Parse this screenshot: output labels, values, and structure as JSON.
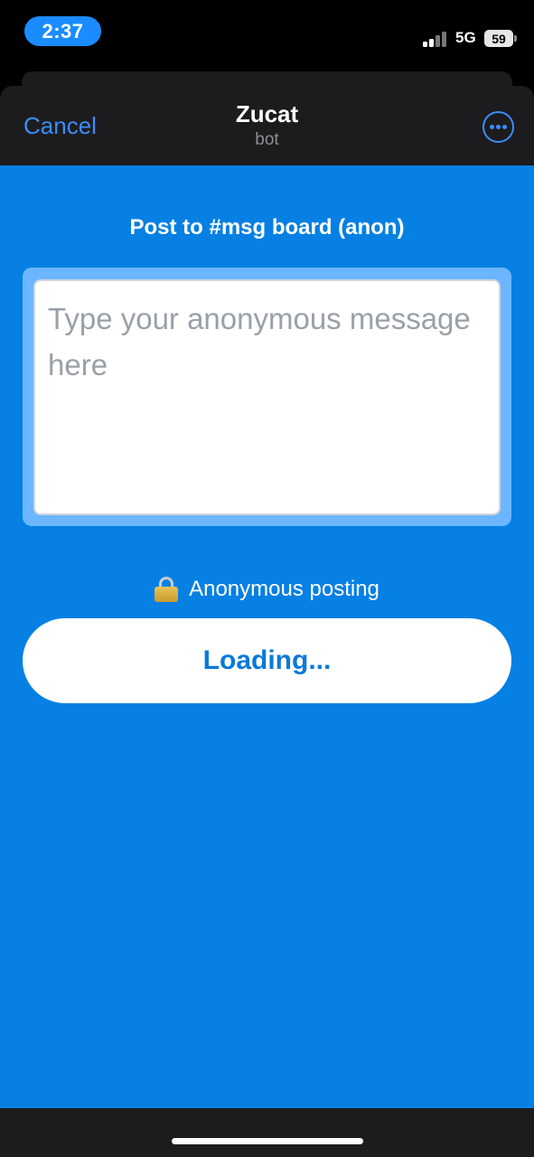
{
  "status_bar": {
    "time": "2:37",
    "network": "5G",
    "battery": "59",
    "icons": [
      "signal-bars-icon",
      "battery-icon"
    ]
  },
  "header": {
    "cancel_label": "Cancel",
    "title": "Zucat",
    "subtitle": "bot",
    "more_icon": "ellipsis-circle-icon"
  },
  "form": {
    "title": "Post to #msg board (anon)",
    "message": {
      "value": "",
      "placeholder": "Type your anonymous message here"
    },
    "anon_label": "Anonymous posting",
    "lock_icon": "lock-icon",
    "submit_label": "Loading..."
  },
  "colors": {
    "app_background": "#0680e3",
    "accent": "#3a8dff",
    "time_pill": "#1a8cff",
    "sheet": "#1c1c1e",
    "button_text": "#0a79d8"
  }
}
